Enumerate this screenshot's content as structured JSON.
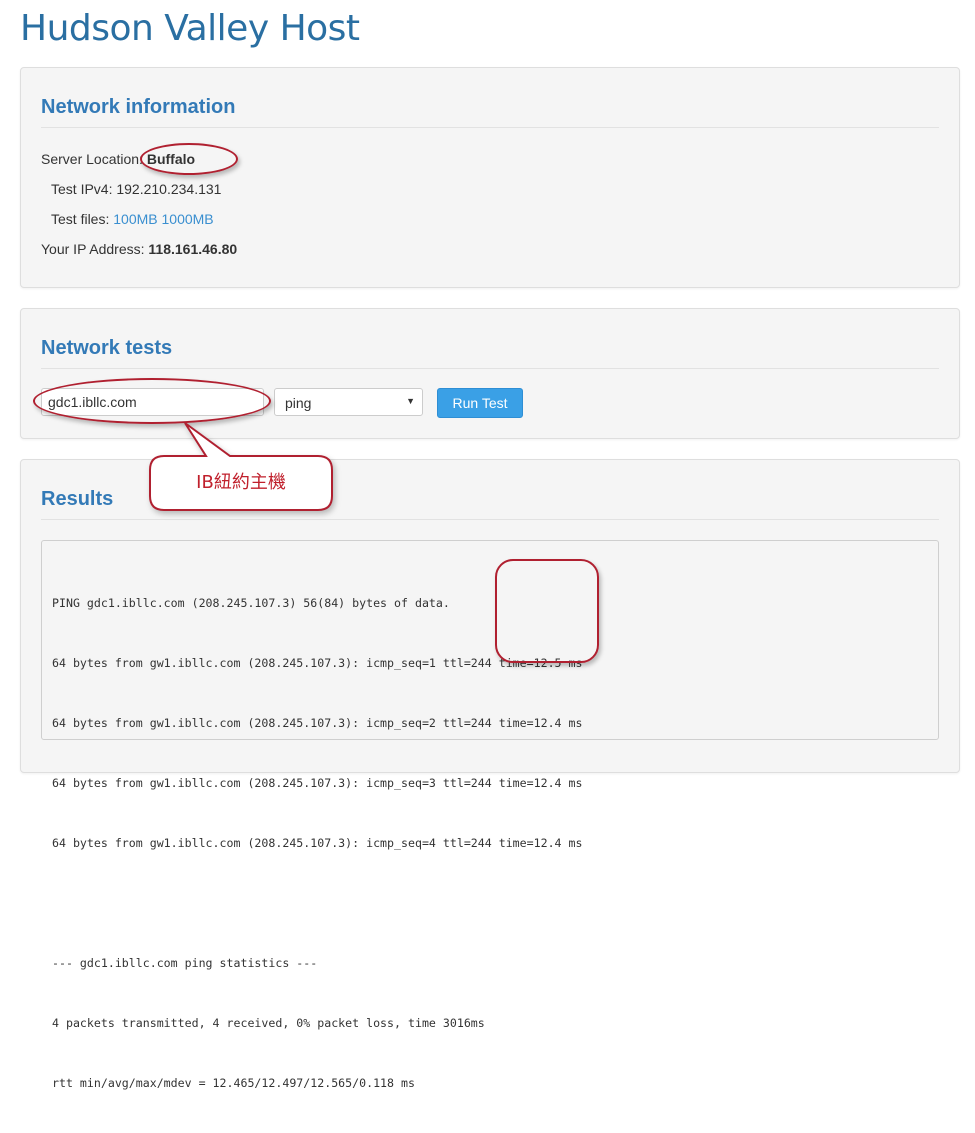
{
  "site": {
    "title": "Hudson Valley Host"
  },
  "network_info": {
    "heading": "Network information",
    "server_location_label": "Server Location:",
    "server_location_value": "Buffalo",
    "test_ipv4_label": "Test IPv4:",
    "test_ipv4_value": "192.210.234.131",
    "test_files_label": "Test files:",
    "test_files": [
      "100MB",
      "1000MB"
    ],
    "your_ip_label": "Your IP Address:",
    "your_ip_value": "118.161.46.80"
  },
  "network_tests": {
    "heading": "Network tests",
    "host_value": "gdc1.ibllc.com",
    "test_type": "ping",
    "run_button": "Run Test"
  },
  "results": {
    "heading": "Results",
    "lines": [
      "PING gdc1.ibllc.com (208.245.107.3) 56(84) bytes of data.",
      "64 bytes from gw1.ibllc.com (208.245.107.3): icmp_seq=1 ttl=244 time=12.5 ms",
      "64 bytes from gw1.ibllc.com (208.245.107.3): icmp_seq=2 ttl=244 time=12.4 ms",
      "64 bytes from gw1.ibllc.com (208.245.107.3): icmp_seq=3 ttl=244 time=12.4 ms",
      "64 bytes from gw1.ibllc.com (208.245.107.3): icmp_seq=4 ttl=244 time=12.4 ms",
      "",
      "--- gdc1.ibllc.com ping statistics ---",
      "4 packets transmitted, 4 received, 0% packet loss, time 3016ms",
      "rtt min/avg/max/mdev = 12.465/12.497/12.565/0.118 ms"
    ]
  },
  "annotation": {
    "callout_text": "IB紐約主機"
  },
  "colors": {
    "title": "#2a6fa2",
    "heading": "#337ab7",
    "link": "#3a8fd0",
    "button": "#3aa0e6",
    "annotation": "#b02030"
  }
}
